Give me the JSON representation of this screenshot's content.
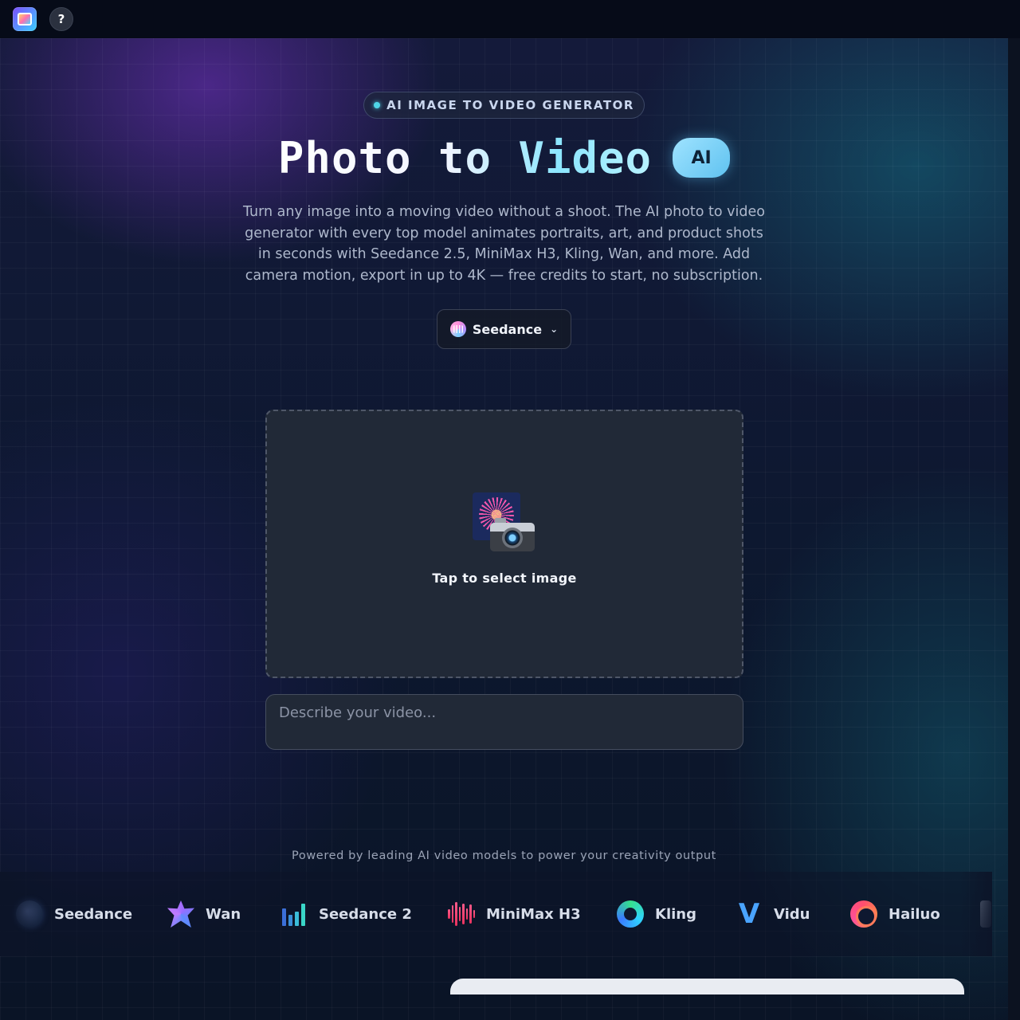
{
  "topbar": {
    "logo_icon": "app-logo-icon",
    "help_label": "?"
  },
  "hero": {
    "badge": "AI IMAGE TO VIDEO GENERATOR",
    "title": "Photo to Video",
    "title_pill": "AI",
    "description": "Turn any image into a moving video without a shoot. The AI photo to video generator with every top model animates portraits, art, and product shots in seconds with Seedance 2.5, MiniMax H3, Kling, Wan, and more. Add camera motion, export in up to 4K — free credits to start, no subscription."
  },
  "model_select": {
    "selected": "Seedance",
    "icon": "seedance-icon",
    "chevron": "⌄"
  },
  "upload": {
    "label": "Tap to select image",
    "icon": "fireworks-camera-icon"
  },
  "prompt": {
    "placeholder": "Describe your video...",
    "value": ""
  },
  "models_strip": {
    "caption": "Powered by leading AI video models to power your creativity output",
    "items": [
      {
        "label": "Seedance",
        "icon": "seedance-orb-icon"
      },
      {
        "label": "Wan",
        "icon": "wan-star-icon"
      },
      {
        "label": "Seedance 2",
        "icon": "seedance-bars-icon"
      },
      {
        "label": "MiniMax H3",
        "icon": "minimax-wave-icon"
      },
      {
        "label": "Kling",
        "icon": "kling-ring-icon"
      },
      {
        "label": "Vidu",
        "icon": "vidu-v-icon"
      },
      {
        "label": "Hailuo",
        "icon": "hailuo-swirl-icon"
      }
    ]
  },
  "colors": {
    "accent_cyan": "#4fd6e8",
    "ai_pill": "#7fd3f8",
    "panel": "#212937",
    "background": "#0b1324"
  }
}
